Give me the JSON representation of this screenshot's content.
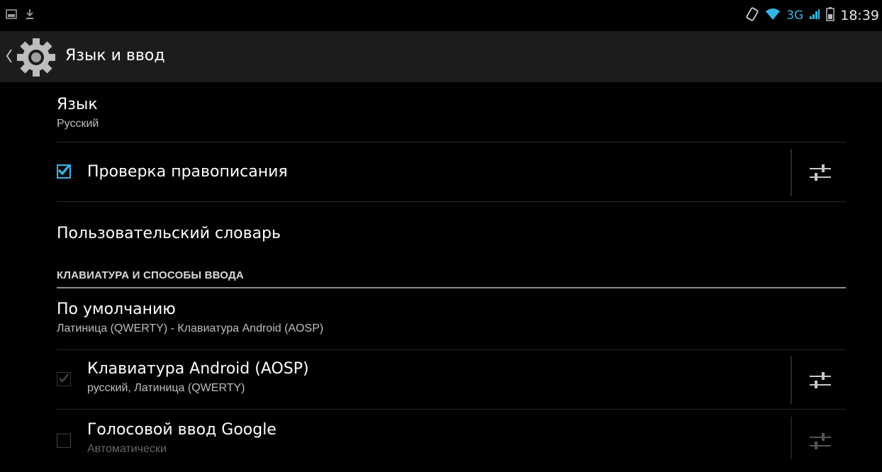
{
  "status_bar": {
    "time": "18:39",
    "network": "3G",
    "left_icons": [
      "screenshot-icon",
      "download-icon"
    ],
    "right_icons": [
      "rotation-icon",
      "wifi-icon",
      "signal-icon",
      "battery-icon"
    ],
    "accent": "#33b5e5"
  },
  "action_bar": {
    "title": "Язык и ввод",
    "icon": "gear-icon"
  },
  "language": {
    "title": "Язык",
    "summary": "Русский"
  },
  "spell_check": {
    "title": "Проверка правописания",
    "checked": true
  },
  "user_dictionary": {
    "title": "Пользовательский словарь"
  },
  "section": {
    "keyboard_methods": "КЛАВИАТУРА И СПОСОБЫ ВВОДА"
  },
  "default": {
    "title": "По умолчанию",
    "summary": "Латиница (QWERTY) - Клавиатура Android (AOSP)"
  },
  "android_keyboard": {
    "title": "Клавиатура Android (AOSP)",
    "summary": "русский, Латиница (QWERTY)",
    "checked": true,
    "enabled": false
  },
  "google_voice": {
    "title": "Голосовой ввод Google",
    "summary": "Автоматически",
    "checked": false
  },
  "colors": {
    "background": "#000000",
    "action_bar": "#1b1c1e",
    "accent": "#33b5e5"
  }
}
